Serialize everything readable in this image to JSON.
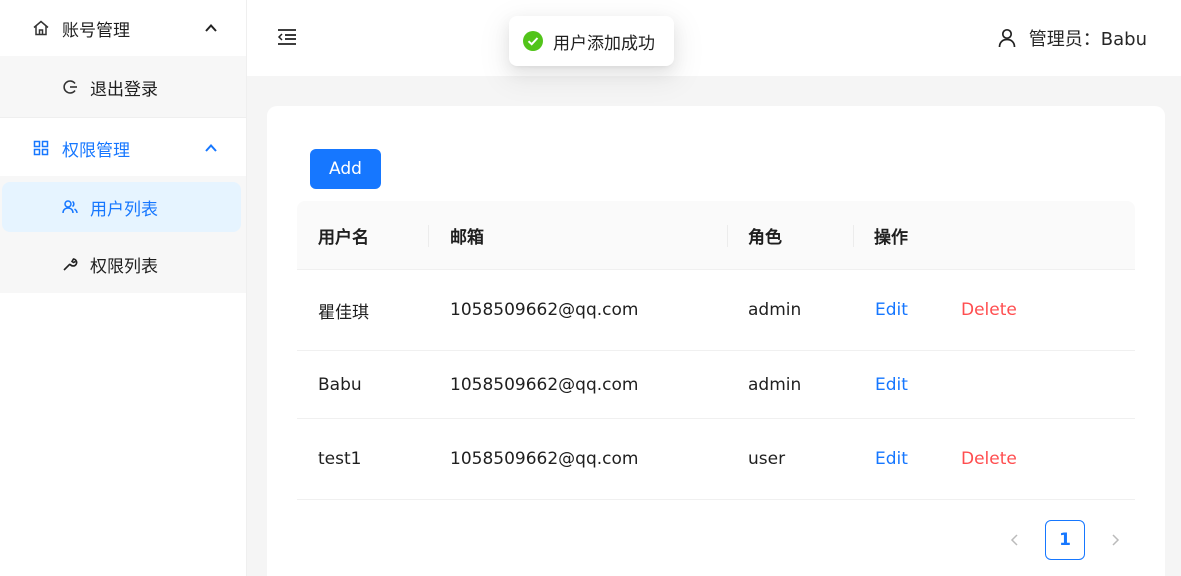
{
  "sidebar": {
    "groups": [
      {
        "label": "账号管理",
        "icon": "home-icon",
        "items": [
          {
            "label": "退出登录",
            "icon": "logout-icon"
          }
        ]
      },
      {
        "label": "权限管理",
        "icon": "appstore-icon",
        "items": [
          {
            "label": "用户列表",
            "icon": "users-icon"
          },
          {
            "label": "权限列表",
            "icon": "wrench-icon"
          }
        ]
      }
    ]
  },
  "header": {
    "user_label": "管理员：Babu"
  },
  "toast": {
    "message": "用户添加成功",
    "icon": "check-circle-icon"
  },
  "toolbar": {
    "add_label": "Add"
  },
  "table": {
    "columns": [
      "用户名",
      "邮箱",
      "角色",
      "操作"
    ],
    "rows": [
      {
        "username": "瞿佳琪",
        "email": "1058509662@qq.com",
        "role": "admin",
        "edit": "Edit",
        "delete": "Delete"
      },
      {
        "username": "Babu",
        "email": "1058509662@qq.com",
        "role": "admin",
        "edit": "Edit",
        "delete": ""
      },
      {
        "username": "test1",
        "email": "1058509662@qq.com",
        "role": "user",
        "edit": "Edit",
        "delete": "Delete"
      }
    ]
  },
  "pagination": {
    "current_page": "1"
  },
  "colors": {
    "primary": "#1677ff",
    "danger": "#ff4d4f",
    "success": "#52c41a",
    "active_bg": "#e6f4ff"
  }
}
